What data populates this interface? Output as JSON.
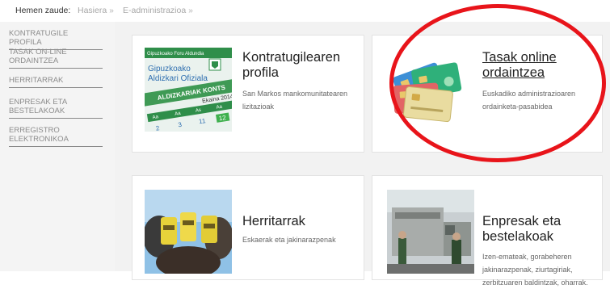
{
  "breadcrumb": {
    "label": "Hemen zaude:",
    "items": [
      {
        "label": "Hasiera",
        "sep": "»"
      },
      {
        "label": "E-administrazioa",
        "sep": "»"
      }
    ]
  },
  "sidebar": {
    "items": [
      {
        "label": "KONTRATUGILE PROFILA"
      },
      {
        "label_l1": "TASAK ON-LINE",
        "label_l2": "ORDAINTZEA"
      },
      {
        "label": "HERRITARRAK"
      },
      {
        "label_l1": "ENPRESAK ETA",
        "label_l2": "BESTELAKOAK"
      },
      {
        "label_l1": "ERREGISTRO",
        "label_l2": "ELEKTRONIKOA"
      }
    ]
  },
  "cards": [
    {
      "title_l1": "Kontratugilearen",
      "title_l2": "profila",
      "desc": [
        "San Markos mankomunitatearen",
        "lizitazioak"
      ],
      "image": {
        "logo_l1": "Gipuzkoako Foru Aldundia",
        "line1": "Gipuzkoako",
        "line2": "Aldizkari Ofiziala",
        "band": "ALDIZKARIAK KONTS",
        "month": "Ekaina 2014",
        "days": [
          "Aa",
          "Aa",
          "As",
          "Aa"
        ],
        "nums": [
          "2",
          "3",
          "11",
          "12"
        ]
      }
    },
    {
      "title_l1": "Tasak online",
      "title_l2": "ordaintzea",
      "desc": [
        "Euskadiko administrazioaren",
        "ordainketa-pasabidea"
      ]
    },
    {
      "title_l1": "Herritarrak",
      "desc": [
        "Eskaerak eta jakinarazpenak"
      ]
    },
    {
      "title_l1": "Enpresak eta",
      "title_l2": "bestelakoak",
      "desc": [
        "Izen-emateak, gorabeheren",
        "jakinarazpenak, ziurtagiriak,",
        "zerbitzuaren baldintzak, oharrak."
      ]
    }
  ],
  "colors": {
    "annotation": "#e8141a",
    "sidebar_bg": "#f4f4f4",
    "main_bg": "#f2f2f2"
  }
}
